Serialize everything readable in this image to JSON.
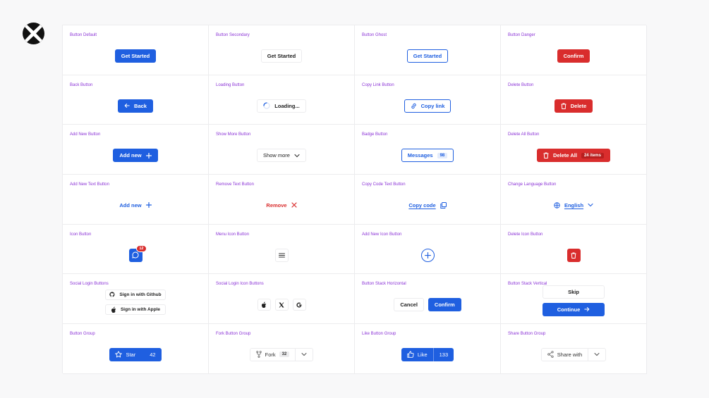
{
  "cells": {
    "button_default": {
      "label": "Button Default",
      "btn": "Get Started"
    },
    "button_secondary": {
      "label": "Button Secondary",
      "btn": "Get Started"
    },
    "button_ghost": {
      "label": "Button Ghost",
      "btn": "Get Started"
    },
    "button_danger": {
      "label": "Button Danger",
      "btn": "Confirm"
    },
    "back": {
      "label": "Back Button",
      "btn": "Back"
    },
    "loading": {
      "label": "Loading Button",
      "btn": "Loading..."
    },
    "copy_link": {
      "label": "Copy Link Button",
      "btn": "Copy link"
    },
    "delete": {
      "label": "Delete Button",
      "btn": "Delete"
    },
    "add_new": {
      "label": "Add New Button",
      "btn": "Add new"
    },
    "show_more": {
      "label": "Show More Button",
      "btn": "Show more"
    },
    "badge": {
      "label": "Badge Button",
      "btn": "Messages",
      "count": "98"
    },
    "delete_all": {
      "label": "Delete All Button",
      "btn": "Delete All",
      "count": "24 items"
    },
    "add_new_text": {
      "label": "Add New Text Button",
      "btn": "Add new"
    },
    "remove_text": {
      "label": "Remove Text Button",
      "btn": "Remove"
    },
    "copy_code": {
      "label": "Copy Code Text Button",
      "btn": "Copy code"
    },
    "change_lang": {
      "label": "Change Language Button",
      "btn": "English"
    },
    "icon": {
      "label": "Icon Button",
      "badge": "12"
    },
    "menu_icon": {
      "label": "Menu Icon Button"
    },
    "add_new_icon": {
      "label": "Add New Icon Button"
    },
    "delete_icon": {
      "label": "Delete Icon Button"
    },
    "social": {
      "label": "Social Login Buttons",
      "github": "Sign in with Github",
      "apple": "Sign in with Apple"
    },
    "social_icon": {
      "label": "Social Login Icon Buttons"
    },
    "stack_h": {
      "label": "Button Stack Horizontal",
      "cancel": "Cancel",
      "confirm": "Confirm"
    },
    "stack_v": {
      "label": "Button Stack Vertical",
      "skip": "Skip",
      "continue": "Continue"
    },
    "group": {
      "label": "Button Group",
      "btn": "Star",
      "count": "42"
    },
    "fork": {
      "label": "Fork Button Group",
      "btn": "Fork",
      "count": "32"
    },
    "like": {
      "label": "Like Button Group",
      "btn": "Like",
      "count": "133"
    },
    "share": {
      "label": "Share Button Group",
      "btn": "Share with"
    }
  },
  "colors": {
    "primary": "#1f5fe0",
    "danger": "#d92d2d",
    "label": "#8b33d6"
  },
  "icons": [
    "brand-logo-icon",
    "arrow-left-icon",
    "spinner-icon",
    "link-icon",
    "trash-icon",
    "plus-icon",
    "chevron-down-icon",
    "close-icon",
    "copy-icon",
    "globe-icon",
    "chat-icon",
    "menu-icon",
    "github-icon",
    "apple-icon",
    "x-icon",
    "google-icon",
    "arrow-right-icon",
    "star-icon",
    "fork-icon",
    "thumbs-up-icon",
    "share-icon"
  ]
}
